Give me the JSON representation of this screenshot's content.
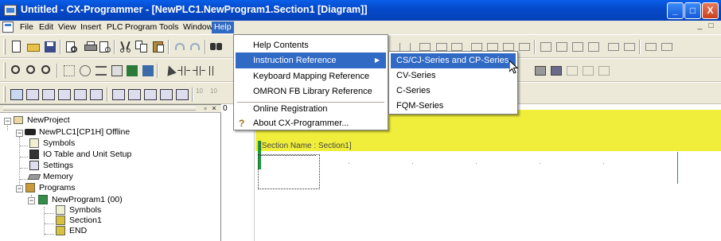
{
  "window": {
    "title": "Untitled - CX-Programmer - [NewPLC1.NewProgram1.Section1 [Diagram]]",
    "controls": [
      "_",
      "□",
      "X"
    ]
  },
  "menubar": {
    "items": [
      "File",
      "Edit",
      "View",
      "Insert",
      "PLC",
      "Program",
      "Tools",
      "Window",
      "Help"
    ],
    "active": "Help",
    "mdi_controls": [
      "_",
      "□",
      "x"
    ]
  },
  "help_menu": {
    "items": [
      {
        "label": "Help Contents",
        "submenu": false
      },
      {
        "label": "Instruction Reference",
        "submenu": true
      },
      {
        "label": "Keyboard Mapping Reference",
        "submenu": false
      },
      {
        "label": "OMRON FB Library Reference",
        "submenu": false
      },
      {
        "label": "Online Registration",
        "submenu": false
      },
      {
        "label": "About CX-Programmer...",
        "submenu": false
      }
    ],
    "highlighted": "Instruction Reference"
  },
  "instruction_submenu": {
    "items": [
      "CS/CJ-Series and CP-Series",
      "CV-Series",
      "C-Series",
      "FQM-Series"
    ],
    "highlighted": "CS/CJ-Series and CP-Series"
  },
  "toolbar": {
    "zoom_labels": [
      "10",
      "10"
    ]
  },
  "project_tree": {
    "nodes": [
      {
        "label": "NewProject",
        "icon": "project-icon"
      },
      {
        "label": "NewPLC1[CP1H] Offline",
        "icon": "plc-icon"
      },
      {
        "label": "Symbols",
        "icon": "symbols-icon"
      },
      {
        "label": "IO Table and Unit Setup",
        "icon": "io-table-icon"
      },
      {
        "label": "Settings",
        "icon": "settings-icon"
      },
      {
        "label": "Memory",
        "icon": "memory-icon"
      },
      {
        "label": "Programs",
        "icon": "programs-icon"
      },
      {
        "label": "NewProgram1 (00)",
        "icon": "program-icon"
      },
      {
        "label": "Symbols",
        "icon": "symbols-icon"
      },
      {
        "label": "Section1",
        "icon": "section-icon"
      },
      {
        "label": "END",
        "icon": "section-icon"
      }
    ]
  },
  "diagram": {
    "rung_number": "0",
    "section_label": "[Section Name : Section1]"
  },
  "colors": {
    "titlebar": "#0548c8",
    "menu_highlight": "#316ac5",
    "rung_band": "#f0ee3a",
    "power_rail": "#1a9a3a"
  }
}
